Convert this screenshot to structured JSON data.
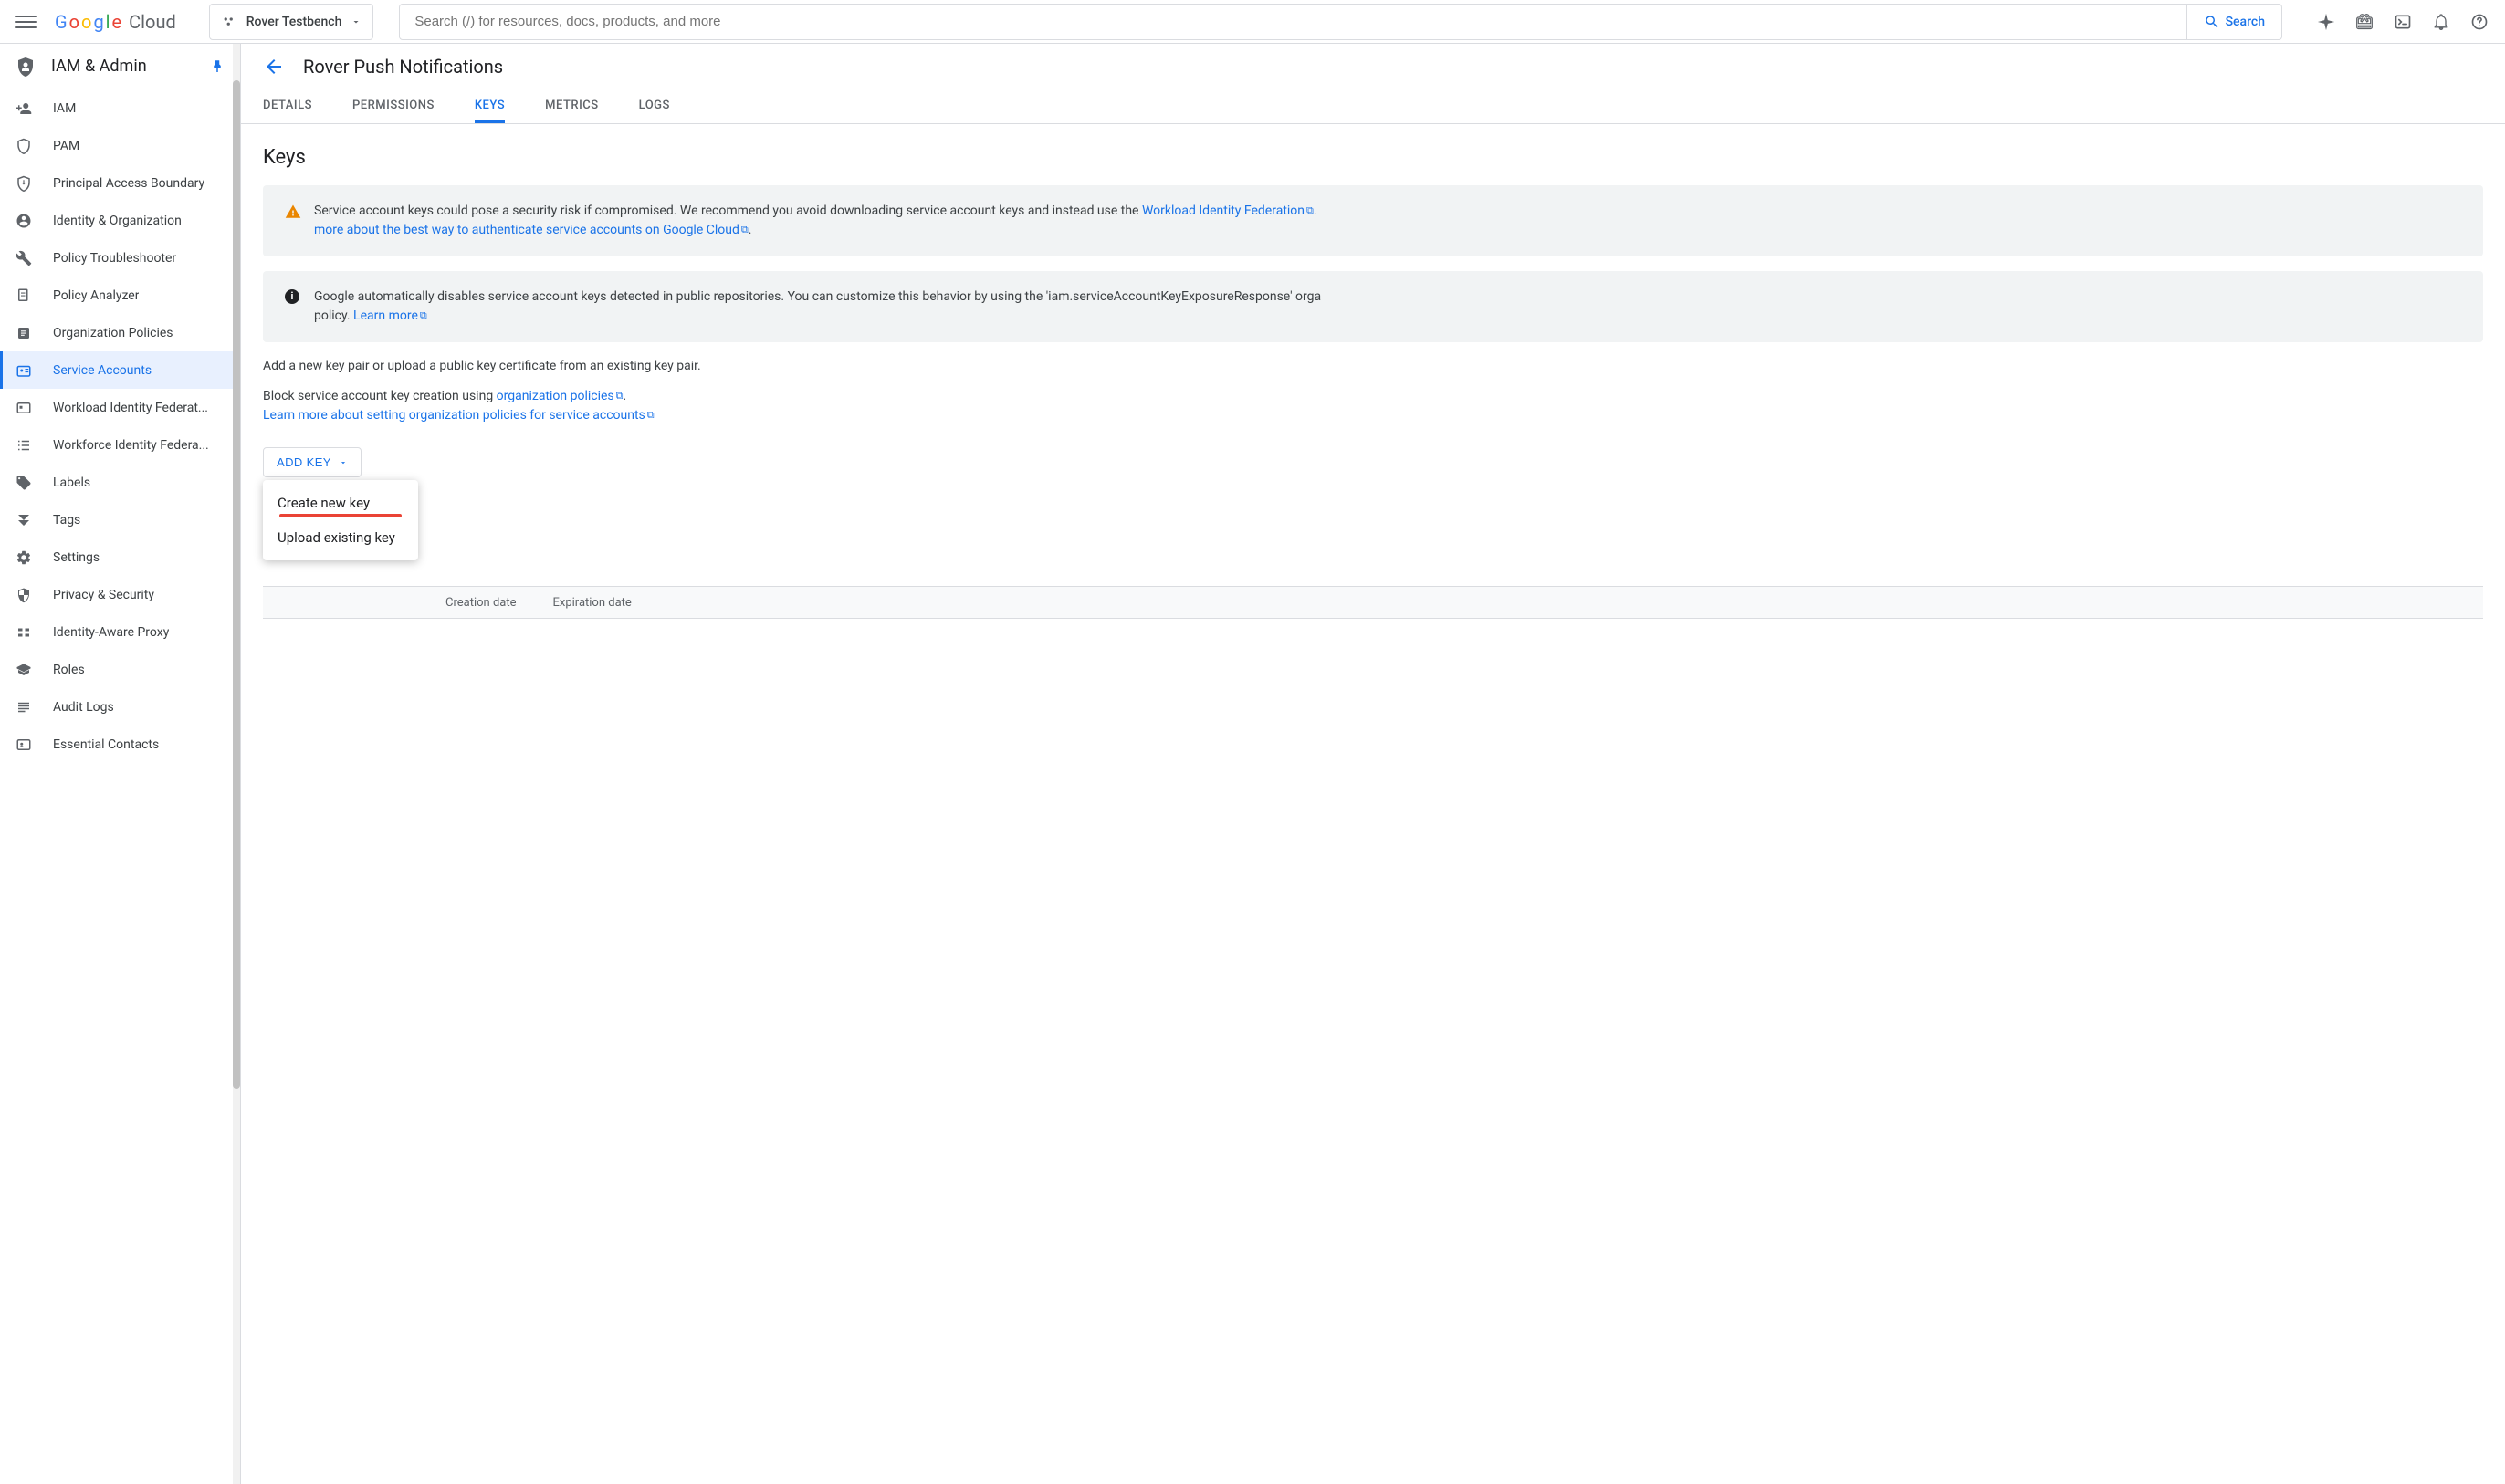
{
  "header": {
    "logo_cloud": "Cloud",
    "project_name": "Rover Testbench",
    "search_placeholder": "Search (/) for resources, docs, products, and more",
    "search_button": "Search"
  },
  "sidebar": {
    "title": "IAM & Admin",
    "items": [
      {
        "label": "IAM",
        "icon": "person-add"
      },
      {
        "label": "PAM",
        "icon": "shield-outline"
      },
      {
        "label": "Principal Access Boundary",
        "icon": "shield-arrow"
      },
      {
        "label": "Identity & Organization",
        "icon": "account-circle"
      },
      {
        "label": "Policy Troubleshooter",
        "icon": "wrench"
      },
      {
        "label": "Policy Analyzer",
        "icon": "doc-search"
      },
      {
        "label": "Organization Policies",
        "icon": "list-box"
      },
      {
        "label": "Service Accounts",
        "icon": "badge",
        "active": true
      },
      {
        "label": "Workload Identity Federat...",
        "icon": "id-card"
      },
      {
        "label": "Workforce Identity Federa...",
        "icon": "list-lines"
      },
      {
        "label": "Labels",
        "icon": "tag"
      },
      {
        "label": "Tags",
        "icon": "bookmark"
      },
      {
        "label": "Settings",
        "icon": "gear"
      },
      {
        "label": "Privacy & Security",
        "icon": "shield-half"
      },
      {
        "label": "Identity-Aware Proxy",
        "icon": "proxy"
      },
      {
        "label": "Roles",
        "icon": "hat"
      },
      {
        "label": "Audit Logs",
        "icon": "lines"
      },
      {
        "label": "Essential Contacts",
        "icon": "contact-card"
      }
    ]
  },
  "main": {
    "page_title": "Rover Push Notifications",
    "tabs": [
      {
        "label": "DETAILS"
      },
      {
        "label": "PERMISSIONS"
      },
      {
        "label": "KEYS",
        "active": true
      },
      {
        "label": "METRICS"
      },
      {
        "label": "LOGS"
      }
    ],
    "heading": "Keys",
    "warning_banner": {
      "text1": "Service account keys could pose a security risk if compromised. We recommend you avoid downloading service account keys and instead use the ",
      "link1": "Workload Identity Federation",
      "text2": ". ",
      "link2": "more about the best way to authenticate service accounts on Google Cloud",
      "text3": "."
    },
    "info_banner": {
      "text1": "Google automatically disables service account keys detected in public repositories. You can customize this behavior by using the 'iam.serviceAccountKeyExposureResponse' orga",
      "text2": "policy. ",
      "link1": "Learn more"
    },
    "add_text": "Add a new key pair or upload a public key certificate from an existing key pair.",
    "block_text1": "Block service account key creation using ",
    "block_link1": "organization policies",
    "block_text2": ".",
    "block_link2": "Learn more about setting organization policies for service accounts",
    "add_key_button": "ADD KEY",
    "dropdown": {
      "create": "Create new key",
      "upload": "Upload existing key"
    },
    "table": {
      "col_creation": "Creation date",
      "col_expiration": "Expiration date"
    }
  }
}
